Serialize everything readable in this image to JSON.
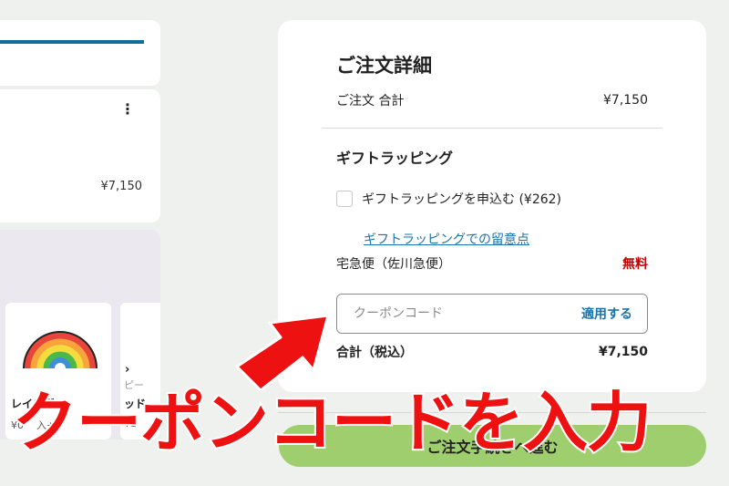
{
  "left": {
    "item_price": "¥7,150",
    "recommendations": [
      {
        "name": "レインボー",
        "price": "¥0",
        "cta": "入+"
      },
      {
        "name": "ッド",
        "price": "¥1",
        "subtitle": "ピー"
      }
    ]
  },
  "order": {
    "title": "ご注文詳細",
    "subtotal_label": "ご注文 合計",
    "subtotal_value": "¥7,150",
    "gift_title": "ギフトラッピング",
    "gift_checkbox_label": "ギフトラッピングを申込む (¥262)",
    "gift_link": "ギフトラッピングでの留意点",
    "shipping_label": "宅急便（佐川急便）",
    "shipping_value": "無料",
    "coupon_placeholder": "クーポンコード",
    "coupon_apply": "適用する",
    "total_label": "合計（税込）",
    "total_value": "¥7,150"
  },
  "checkout_button": "ご注文手続きへ進む",
  "overlay_caption": "クーポンコードを入力",
  "colors": {
    "accent_blue": "#1a74a8",
    "free_red": "#c40000",
    "checkout_green": "#9fce6e",
    "annotation_red": "#ee1111"
  },
  "icons": [
    "kebab-menu-icon",
    "chevron-right-icon",
    "rainbow-product-image",
    "red-arrow-annotation"
  ]
}
